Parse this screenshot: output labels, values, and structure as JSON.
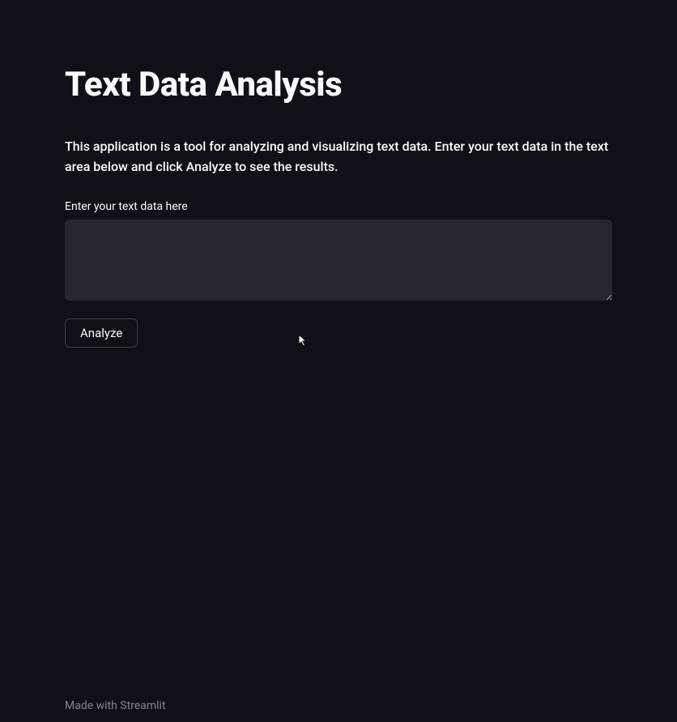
{
  "header": {
    "title": "Text Data Analysis"
  },
  "main": {
    "description": "This application is a tool for analyzing and visualizing text data. Enter your text data in the text area below and click Analyze to see the results.",
    "input": {
      "label": "Enter your text data here",
      "value": "",
      "placeholder": ""
    },
    "button": {
      "analyze_label": "Analyze"
    }
  },
  "footer": {
    "prefix": "Made with ",
    "link_text": "Streamlit"
  }
}
